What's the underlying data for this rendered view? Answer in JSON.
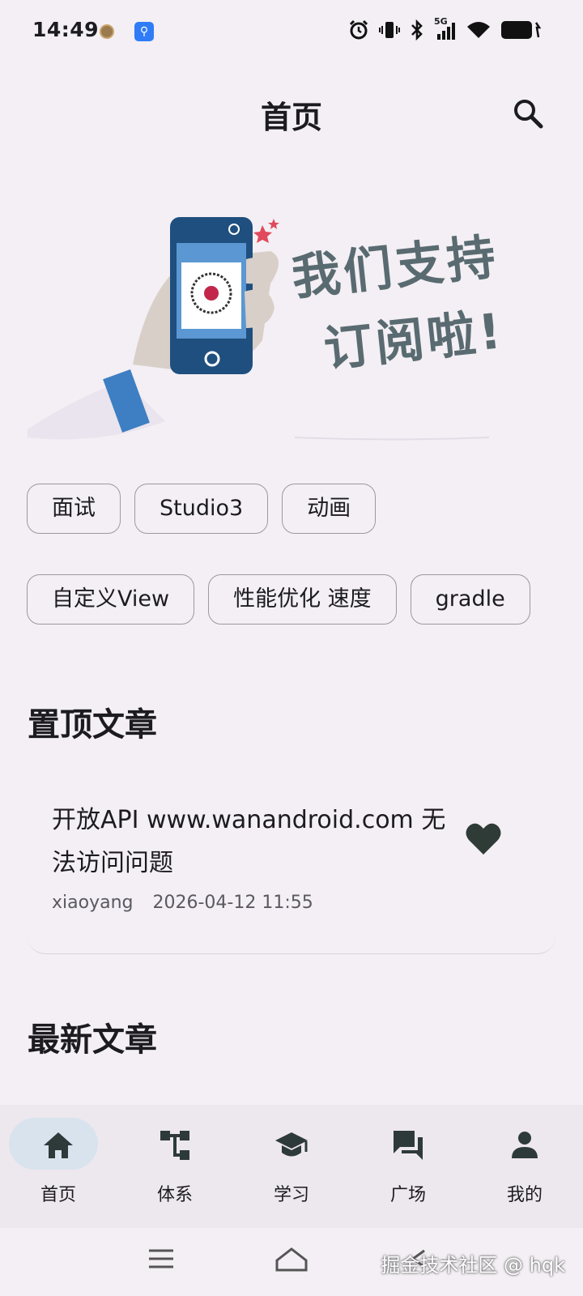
{
  "status_bar": {
    "time": "14:49",
    "network": "5G"
  },
  "header": {
    "title": "首页"
  },
  "banner": {
    "line1": "我们支持",
    "line2": "订阅啦!"
  },
  "tags": {
    "row1": [
      "面试",
      "Studio3",
      "动画"
    ],
    "row2": [
      "自定义View",
      "性能优化 速度",
      "gradle"
    ]
  },
  "pinned": {
    "title": "置顶文章",
    "article": {
      "title": "开放API www.wanandroid.com 无法访问问题",
      "author": "xiaoyang",
      "date": "2026-04-12 11:55"
    }
  },
  "latest": {
    "title": "最新文章"
  },
  "bottom_nav": {
    "items": [
      {
        "label": "首页",
        "icon": "home-icon",
        "active": true
      },
      {
        "label": "体系",
        "icon": "tree-icon",
        "active": false
      },
      {
        "label": "学习",
        "icon": "school-icon",
        "active": false
      },
      {
        "label": "广场",
        "icon": "forum-icon",
        "active": false
      },
      {
        "label": "我的",
        "icon": "person-icon",
        "active": false
      }
    ]
  },
  "watermark": "掘金技术社区 @ hqk",
  "colors": {
    "background": "#f3eff4",
    "nav_active_pill": "#d9e3ee",
    "icon_dark": "#2e3a3a",
    "banner_text": "#596b70"
  }
}
